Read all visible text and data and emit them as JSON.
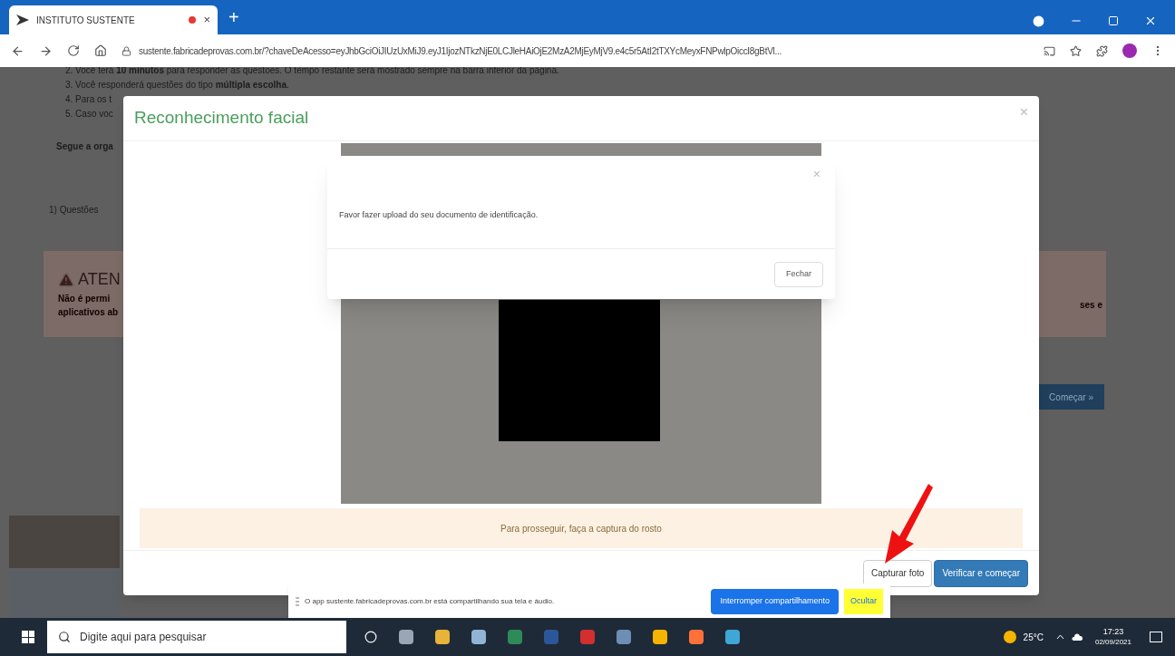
{
  "browser": {
    "tab": {
      "title": "INSTITUTO SUSTENTE",
      "recording": true,
      "close": "×"
    },
    "new_tab": "+",
    "url": "sustente.fabricadeprovas.com.br/?chaveDeAcesso=eyJhbGciOiJIUzUxMiJ9.eyJ1IjozNTkzNjE0LCJleHAiOjE2MzA2MjEyMjV9.e4c5r5AtI2tTXYcMeyxFNPwlpOiccI8gBtVl..."
  },
  "page": {
    "instructions": [
      "2. Você terá **10 minutos** para responder as questões. O tempo restante será mostrado sempre na barra inferior da página.",
      "3. Você responderá questões do tipo **múltipla escolha**.",
      "4. Para os t",
      "5. Caso voc"
    ],
    "section_note": "Segue a orga",
    "questions_tab": "1) Questões",
    "alert": {
      "title": "ATEN",
      "lines": [
        "Não é permi",
        "aplicativos ab"
      ],
      "right_text": "ses e"
    },
    "start_button": "Começar »"
  },
  "modal": {
    "title": "Reconhecimento facial",
    "close": "×",
    "notice": "Para prosseguir, faça a captura do rosto",
    "buttons": [
      {
        "label": "Capturar foto",
        "kind": "default"
      },
      {
        "label": "Verificar e começar",
        "kind": "primary"
      }
    ]
  },
  "alert_dialog": {
    "close": "×",
    "message": "Favor fazer upload do seu documento de identificação.",
    "button": "Fechar"
  },
  "share_bar": {
    "message": "O app sustente.fabricadeprovas.com.br está compartilhando sua tela e áudio.",
    "stop_button": "Interromper compartilhamento",
    "hide_button": "Ocultar"
  },
  "taskbar": {
    "search_placeholder": "Digite aqui para pesquisar",
    "weather": "25°C",
    "time": "17:23",
    "date": "02/09/2021"
  }
}
